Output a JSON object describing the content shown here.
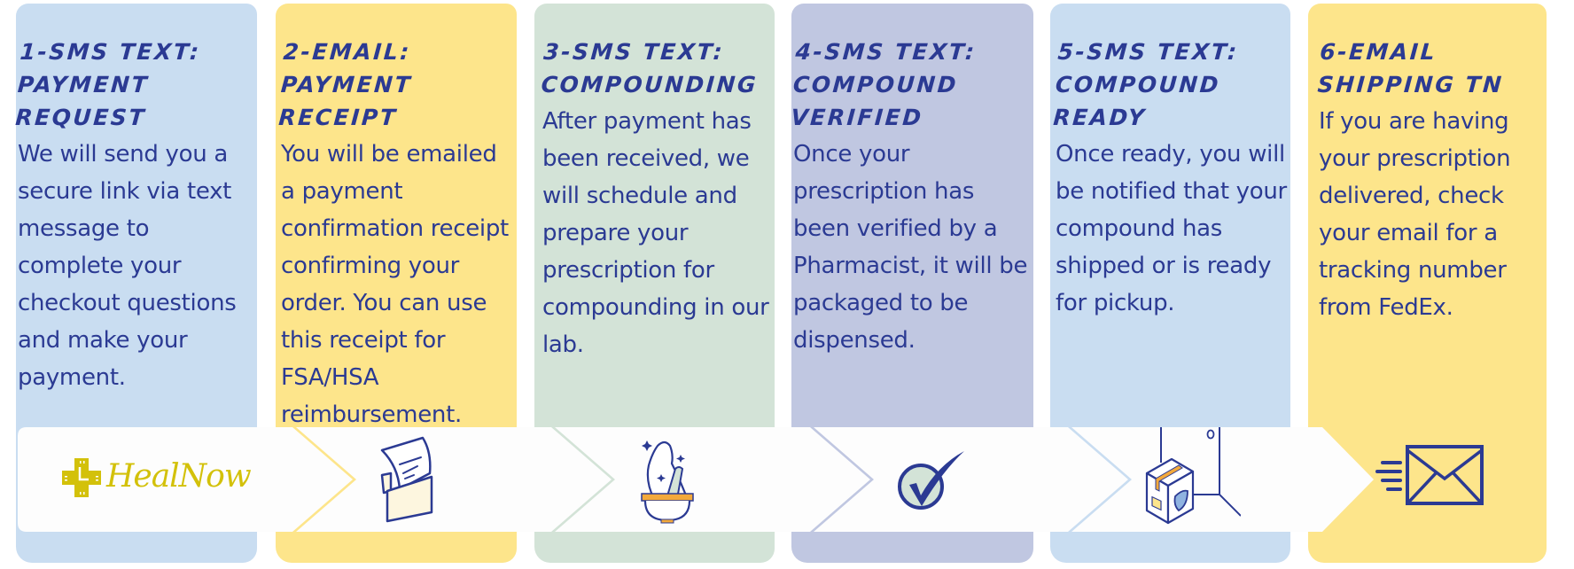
{
  "colors": {
    "text": "#2b3a93",
    "blue": "#c9ddf1",
    "yellow": "#fde58b",
    "green": "#d3e3d7",
    "lavender": "#c0c7e1",
    "logo": "#d3c10a",
    "accent_orange": "#f3a93b"
  },
  "logo": {
    "name": "HealNow"
  },
  "steps": [
    {
      "title": "1-SMS TEXT:\nPAYMENT REQUEST",
      "body": "We will send you a secure link via text message to complete your checkout questions and make your payment.",
      "icon": "healnow-logo"
    },
    {
      "title": "2-EMAIL:\nPAYMENT RECEIPT",
      "body": "You will be emailed a payment confirmation receipt confirming your order. You can use this receipt for FSA/HSA reimbursement.",
      "icon": "receipt-icon"
    },
    {
      "title": "3-SMS TEXT:\nCOMPOUNDING",
      "body": "After payment has been received, we will schedule and prepare your prescription for compounding in our lab.",
      "icon": "mortar-pestle-icon"
    },
    {
      "title": "4-SMS TEXT:\nCOMPOUND VERIFIED",
      "body": "Once your prescription has been verified by a Pharmacist, it will be packaged to be dispensed.",
      "icon": "check-circle-icon"
    },
    {
      "title": "5-SMS TEXT:\nCOMPOUND READY",
      "body": "Once ready, you will be notified that your compound has shipped or is ready for pickup.",
      "icon": "package-door-icon"
    },
    {
      "title": "6-EMAIL\nSHIPPING TN",
      "body": "If you are having your prescription delivered, check your email for a tracking number from FedEx.",
      "icon": "email-send-icon"
    }
  ]
}
